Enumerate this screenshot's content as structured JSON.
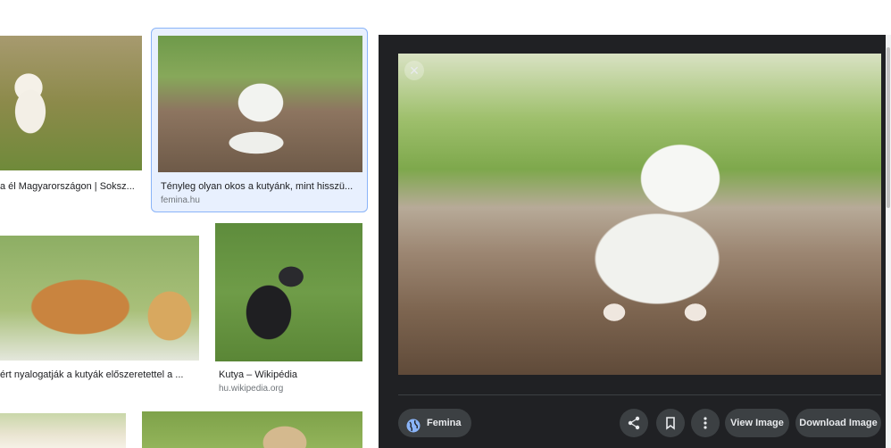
{
  "results": [
    {
      "caption": "a él Magyarországon | Soksz...",
      "source": ""
    },
    {
      "caption": "Tényleg olyan okos a kutyánk, mint hisszü...",
      "source": "femina.hu"
    },
    {
      "caption": "ért nyalogatják a kutyák előszeretettel a ...",
      "source": ""
    },
    {
      "caption": "Kutya – Wikipédia",
      "source": "hu.wikipedia.org"
    }
  ],
  "preview": {
    "source_name": "Femina",
    "view_image_label": "View Image",
    "download_image_label": "Download Image",
    "close_glyph": "✕"
  }
}
